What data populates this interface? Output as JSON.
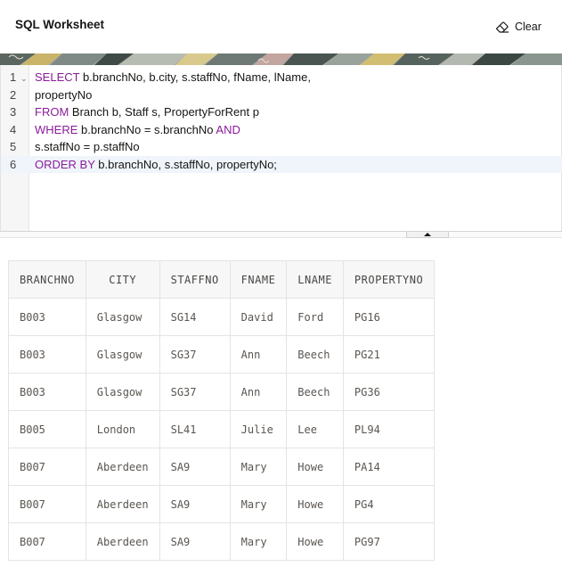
{
  "header": {
    "title": "SQL Worksheet",
    "clear_label": "Clear"
  },
  "colors": {
    "keyword": "#8a1c9a",
    "text": "#161513",
    "active_line": "#f0f5fb",
    "banner_base": "#a7aba3"
  },
  "icons": {
    "clear": "eraser-icon",
    "resize": "triangle-up-icon",
    "fold": "chevron-down-icon"
  },
  "editor": {
    "active_line": 6,
    "lines": [
      {
        "num": "1",
        "kw1": "SELECT",
        "text1": " b.branchNo, b.city, s.staffNo, fName, lName,",
        "kw2": "",
        "text2": ""
      },
      {
        "num": "2",
        "kw1": "",
        "text1": "propertyNo",
        "kw2": "",
        "text2": ""
      },
      {
        "num": "3",
        "kw1": "FROM",
        "text1": " Branch b, Staff s, PropertyForRent p",
        "kw2": "",
        "text2": ""
      },
      {
        "num": "4",
        "kw1": "WHERE",
        "text1": " b.branchNo = s.branchNo ",
        "kw2": "AND",
        "text2": ""
      },
      {
        "num": "5",
        "kw1": "",
        "text1": "s.staffNo = p.staffNo",
        "kw2": "",
        "text2": ""
      },
      {
        "num": "6",
        "kw1": "ORDER BY",
        "text1": " b.branchNo, s.staffNo, propertyNo;",
        "kw2": "",
        "text2": ""
      }
    ]
  },
  "results": {
    "columns": [
      "BRANCHNO",
      "CITY",
      "STAFFNO",
      "FNAME",
      "LNAME",
      "PROPERTYNO"
    ],
    "rows": [
      [
        "B003",
        "Glasgow",
        "SG14",
        "David",
        "Ford",
        "PG16"
      ],
      [
        "B003",
        "Glasgow",
        "SG37",
        "Ann",
        "Beech",
        "PG21"
      ],
      [
        "B003",
        "Glasgow",
        "SG37",
        "Ann",
        "Beech",
        "PG36"
      ],
      [
        "B005",
        "London",
        "SL41",
        "Julie",
        "Lee",
        "PL94"
      ],
      [
        "B007",
        "Aberdeen",
        "SA9",
        "Mary",
        "Howe",
        "PA14"
      ],
      [
        "B007",
        "Aberdeen",
        "SA9",
        "Mary",
        "Howe",
        "PG4"
      ],
      [
        "B007",
        "Aberdeen",
        "SA9",
        "Mary",
        "Howe",
        "PG97"
      ]
    ]
  }
}
